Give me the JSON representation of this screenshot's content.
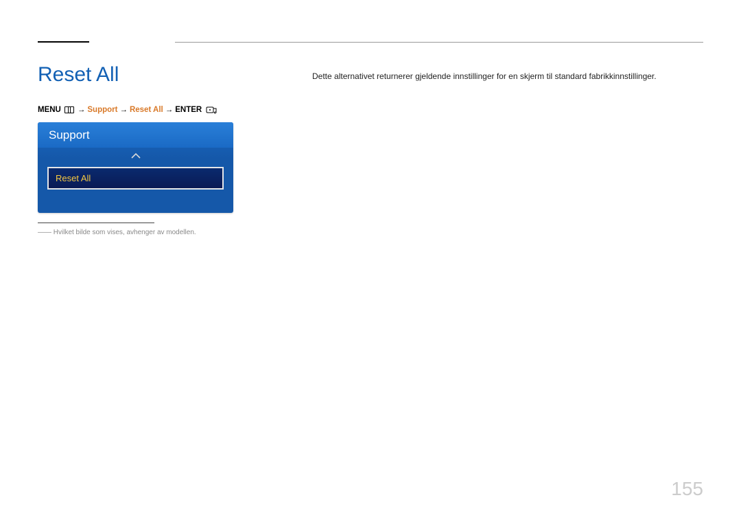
{
  "title": "Reset All",
  "breadcrumb": {
    "menu": "MENU",
    "arrow1": "→",
    "support": "Support",
    "arrow2": "→",
    "reset": "Reset All",
    "arrow3": "→",
    "enter": "ENTER"
  },
  "osd": {
    "header": "Support",
    "selected_item": "Reset All"
  },
  "footnote": "――   Hvilket bilde som vises, avhenger av modellen.",
  "body": "Dette alternativet returnerer gjeldende innstillinger for en skjerm til standard fabrikkinnstillinger.",
  "page_number": "155"
}
